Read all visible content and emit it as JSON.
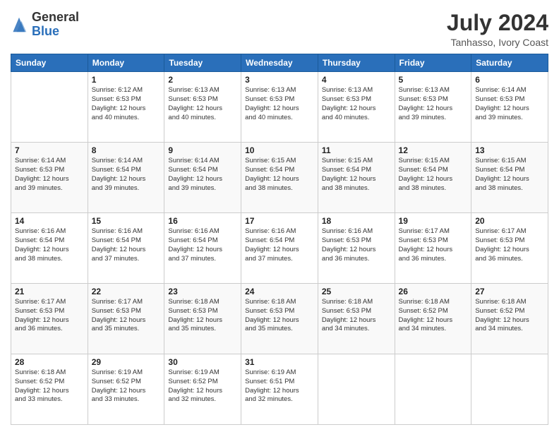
{
  "logo": {
    "general": "General",
    "blue": "Blue"
  },
  "title": "July 2024",
  "subtitle": "Tanhasso, Ivory Coast",
  "days_header": [
    "Sunday",
    "Monday",
    "Tuesday",
    "Wednesday",
    "Thursday",
    "Friday",
    "Saturday"
  ],
  "weeks": [
    [
      {
        "num": "",
        "info": ""
      },
      {
        "num": "1",
        "info": "Sunrise: 6:12 AM\nSunset: 6:53 PM\nDaylight: 12 hours\nand 40 minutes."
      },
      {
        "num": "2",
        "info": "Sunrise: 6:13 AM\nSunset: 6:53 PM\nDaylight: 12 hours\nand 40 minutes."
      },
      {
        "num": "3",
        "info": "Sunrise: 6:13 AM\nSunset: 6:53 PM\nDaylight: 12 hours\nand 40 minutes."
      },
      {
        "num": "4",
        "info": "Sunrise: 6:13 AM\nSunset: 6:53 PM\nDaylight: 12 hours\nand 40 minutes."
      },
      {
        "num": "5",
        "info": "Sunrise: 6:13 AM\nSunset: 6:53 PM\nDaylight: 12 hours\nand 39 minutes."
      },
      {
        "num": "6",
        "info": "Sunrise: 6:14 AM\nSunset: 6:53 PM\nDaylight: 12 hours\nand 39 minutes."
      }
    ],
    [
      {
        "num": "7",
        "info": "Sunrise: 6:14 AM\nSunset: 6:53 PM\nDaylight: 12 hours\nand 39 minutes."
      },
      {
        "num": "8",
        "info": "Sunrise: 6:14 AM\nSunset: 6:54 PM\nDaylight: 12 hours\nand 39 minutes."
      },
      {
        "num": "9",
        "info": "Sunrise: 6:14 AM\nSunset: 6:54 PM\nDaylight: 12 hours\nand 39 minutes."
      },
      {
        "num": "10",
        "info": "Sunrise: 6:15 AM\nSunset: 6:54 PM\nDaylight: 12 hours\nand 38 minutes."
      },
      {
        "num": "11",
        "info": "Sunrise: 6:15 AM\nSunset: 6:54 PM\nDaylight: 12 hours\nand 38 minutes."
      },
      {
        "num": "12",
        "info": "Sunrise: 6:15 AM\nSunset: 6:54 PM\nDaylight: 12 hours\nand 38 minutes."
      },
      {
        "num": "13",
        "info": "Sunrise: 6:15 AM\nSunset: 6:54 PM\nDaylight: 12 hours\nand 38 minutes."
      }
    ],
    [
      {
        "num": "14",
        "info": "Sunrise: 6:16 AM\nSunset: 6:54 PM\nDaylight: 12 hours\nand 38 minutes."
      },
      {
        "num": "15",
        "info": "Sunrise: 6:16 AM\nSunset: 6:54 PM\nDaylight: 12 hours\nand 37 minutes."
      },
      {
        "num": "16",
        "info": "Sunrise: 6:16 AM\nSunset: 6:54 PM\nDaylight: 12 hours\nand 37 minutes."
      },
      {
        "num": "17",
        "info": "Sunrise: 6:16 AM\nSunset: 6:54 PM\nDaylight: 12 hours\nand 37 minutes."
      },
      {
        "num": "18",
        "info": "Sunrise: 6:16 AM\nSunset: 6:53 PM\nDaylight: 12 hours\nand 36 minutes."
      },
      {
        "num": "19",
        "info": "Sunrise: 6:17 AM\nSunset: 6:53 PM\nDaylight: 12 hours\nand 36 minutes."
      },
      {
        "num": "20",
        "info": "Sunrise: 6:17 AM\nSunset: 6:53 PM\nDaylight: 12 hours\nand 36 minutes."
      }
    ],
    [
      {
        "num": "21",
        "info": "Sunrise: 6:17 AM\nSunset: 6:53 PM\nDaylight: 12 hours\nand 36 minutes."
      },
      {
        "num": "22",
        "info": "Sunrise: 6:17 AM\nSunset: 6:53 PM\nDaylight: 12 hours\nand 35 minutes."
      },
      {
        "num": "23",
        "info": "Sunrise: 6:18 AM\nSunset: 6:53 PM\nDaylight: 12 hours\nand 35 minutes."
      },
      {
        "num": "24",
        "info": "Sunrise: 6:18 AM\nSunset: 6:53 PM\nDaylight: 12 hours\nand 35 minutes."
      },
      {
        "num": "25",
        "info": "Sunrise: 6:18 AM\nSunset: 6:53 PM\nDaylight: 12 hours\nand 34 minutes."
      },
      {
        "num": "26",
        "info": "Sunrise: 6:18 AM\nSunset: 6:52 PM\nDaylight: 12 hours\nand 34 minutes."
      },
      {
        "num": "27",
        "info": "Sunrise: 6:18 AM\nSunset: 6:52 PM\nDaylight: 12 hours\nand 34 minutes."
      }
    ],
    [
      {
        "num": "28",
        "info": "Sunrise: 6:18 AM\nSunset: 6:52 PM\nDaylight: 12 hours\nand 33 minutes."
      },
      {
        "num": "29",
        "info": "Sunrise: 6:19 AM\nSunset: 6:52 PM\nDaylight: 12 hours\nand 33 minutes."
      },
      {
        "num": "30",
        "info": "Sunrise: 6:19 AM\nSunset: 6:52 PM\nDaylight: 12 hours\nand 32 minutes."
      },
      {
        "num": "31",
        "info": "Sunrise: 6:19 AM\nSunset: 6:51 PM\nDaylight: 12 hours\nand 32 minutes."
      },
      {
        "num": "",
        "info": ""
      },
      {
        "num": "",
        "info": ""
      },
      {
        "num": "",
        "info": ""
      }
    ]
  ]
}
